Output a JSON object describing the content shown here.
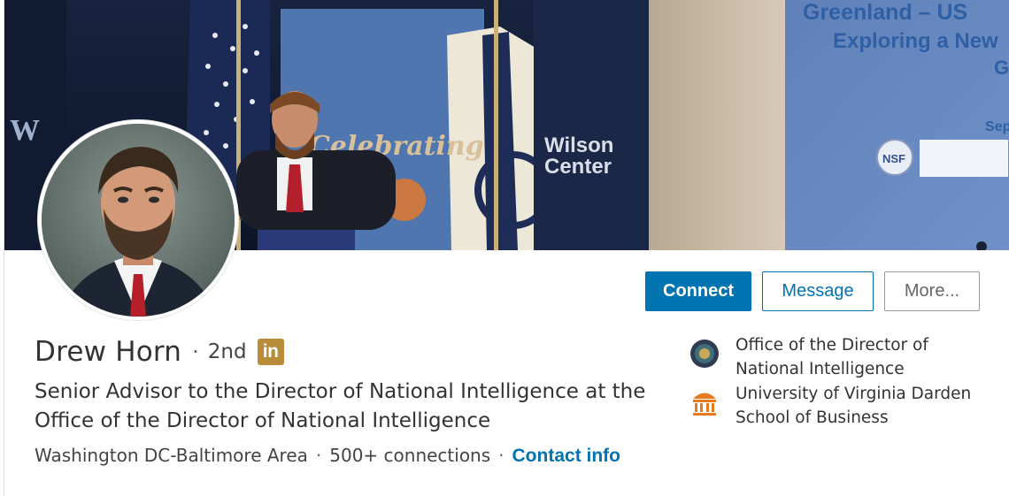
{
  "profile": {
    "name": "Drew Horn",
    "degree": "2nd",
    "premium_badge": "in",
    "headline": "Senior Advisor to the Director of National Intelligence at the Office of the Director of National Intelligence",
    "location": "Washington DC-Baltimore Area",
    "connections": "500+ connections",
    "contact_info": "Contact info",
    "separator": "·"
  },
  "actions": {
    "connect": "Connect",
    "message": "Message",
    "more": "More..."
  },
  "organizations": [
    {
      "name": "Office of the Director of National Intelligence",
      "icon": "odni-seal-icon"
    },
    {
      "name": "University of Virginia Darden School of Business",
      "icon": "darden-logo-icon"
    }
  ],
  "banner": {
    "banner_text_1": "Greenland – US",
    "banner_text_2": "Exploring a New",
    "banner_text_3": "G",
    "banner_text_4": "Sep",
    "banner_text_5": "Celebrating",
    "banner_text_6": "Wilson",
    "banner_text_7": "Center",
    "banner_text_8": "NSF"
  },
  "colors": {
    "accent": "#0073b1",
    "badge": "#b98c3a"
  }
}
